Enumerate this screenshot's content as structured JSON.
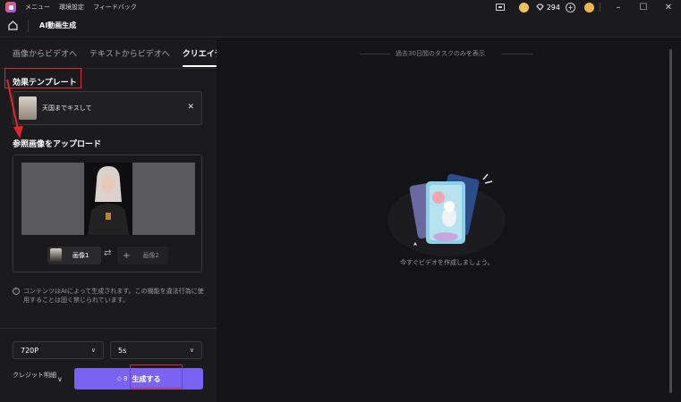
{
  "titlebar": {
    "menu": [
      "メニュー",
      "環境設定",
      "フィードバック"
    ],
    "credits": "294"
  },
  "header": {
    "title": "AI動画生成"
  },
  "tabs": [
    "画像からビデオへ",
    "テキストからビデオへ",
    "クリエイティ"
  ],
  "template_section": {
    "title": "効果テンプレート",
    "template_name": "天国までキスして"
  },
  "upload_section": {
    "title": "参照画像をアップロード",
    "image1_label": "画像1",
    "image2_label": "画像2"
  },
  "notice": "コンテンツはAIによって生成されます。この機能を違法行為に使用することは固く禁じられています。",
  "settings": {
    "resolution": "720P",
    "duration": "5s"
  },
  "footer": {
    "credit_detail": "クレジット明細",
    "generate_cost": "8",
    "generate_label": "生成する"
  },
  "history": {
    "range_label": "過去30日間のタスクのみを表示",
    "empty_message": "今すぐビデオを作成しましょう。"
  },
  "colors": {
    "accent": "#7b63f2",
    "highlight": "#e0262b"
  }
}
